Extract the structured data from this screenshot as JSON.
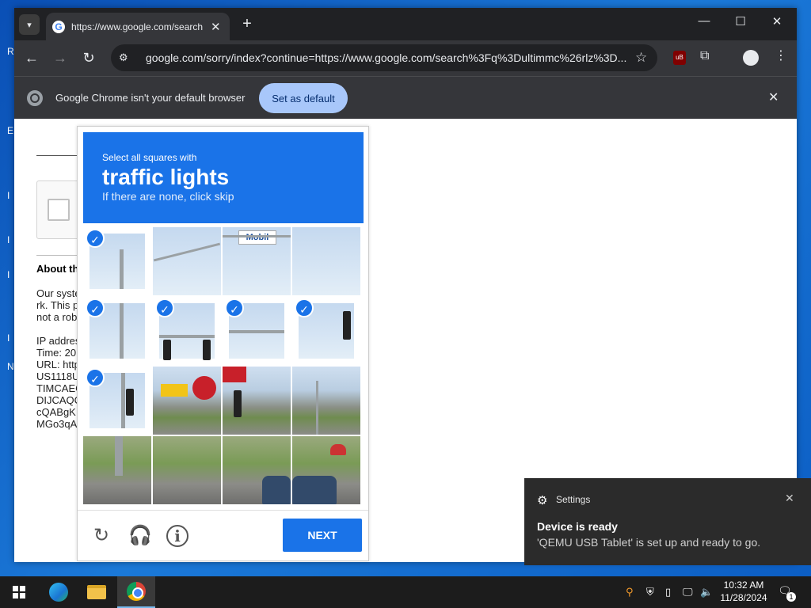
{
  "browser": {
    "tab_title": "https://www.google.com/search",
    "url": "google.com/sorry/index?continue=https://www.google.com/search%3Fq%3Dultimmc%26rlz%3D...",
    "infobar_text": "Google Chrome isn't your default browser",
    "set_default_label": "Set as default"
  },
  "page": {
    "about_heading": "About th",
    "para1": "Our syste\nrk. This p\nnot a rob",
    "para2": "IP addres\nTime: 20\nURL: http\nUS1118U\nTIMCAEC\nDIJCAQC\ncQABgK\nMGo3qA"
  },
  "captcha": {
    "instruction": "Select all squares with",
    "target": "traffic lights",
    "hint": "If there are none, click skip",
    "next_label": "NEXT",
    "sign_text": "Mobil",
    "selected_cells": [
      0,
      4,
      5,
      6,
      7,
      8
    ]
  },
  "desktop_fragments": [
    "R",
    "E",
    "I",
    "I",
    "I",
    "I",
    "N"
  ],
  "notification": {
    "app": "Settings",
    "title": "Device is ready",
    "body": "'QEMU USB Tablet' is set up and ready to go."
  },
  "taskbar": {
    "time": "10:32 AM",
    "date": "11/28/2024",
    "notification_count": "1"
  }
}
